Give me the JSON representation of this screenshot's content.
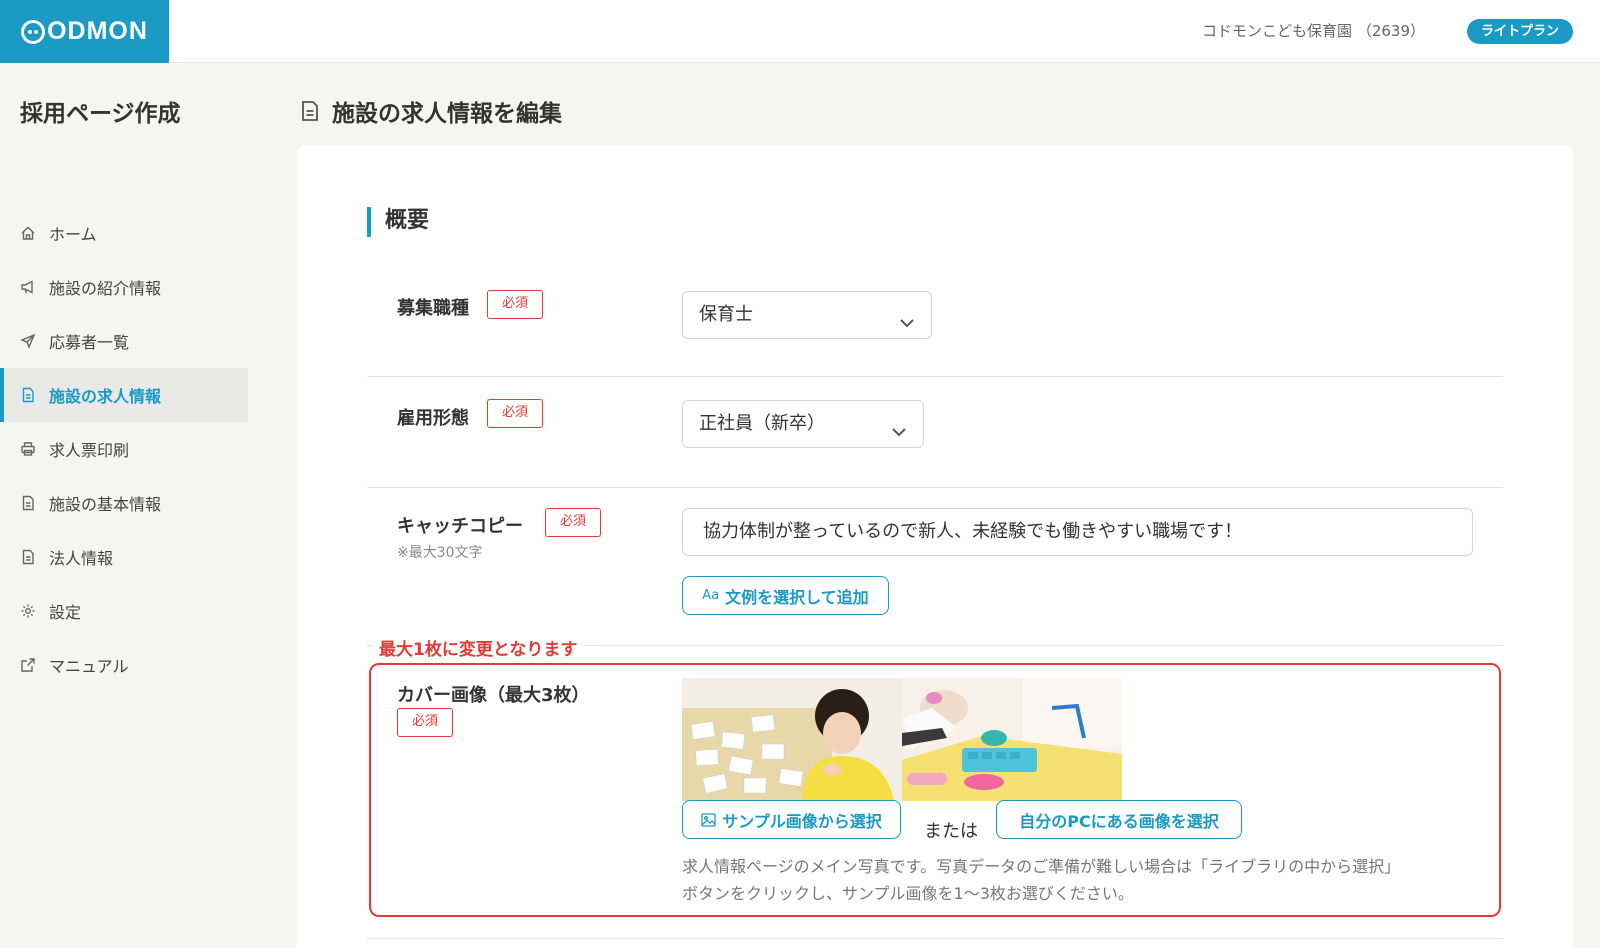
{
  "header": {
    "logo_text": "ODMON",
    "facility_name": "コドモンこども保育園 （2639）",
    "plan_badge": "ライトプラン",
    "brand_color": "#1a9ac4"
  },
  "sidebar": {
    "title": "採用ページ作成",
    "items": [
      {
        "label": "ホーム",
        "icon": "home-icon"
      },
      {
        "label": "施設の紹介情報",
        "icon": "megaphone-icon"
      },
      {
        "label": "応募者一覧",
        "icon": "send-icon"
      },
      {
        "label": "施設の求人情報",
        "icon": "document-icon",
        "active": true
      },
      {
        "label": "求人票印刷",
        "icon": "printer-icon"
      },
      {
        "label": "施設の基本情報",
        "icon": "document-icon"
      },
      {
        "label": "法人情報",
        "icon": "document-icon"
      },
      {
        "label": "設定",
        "icon": "gear-icon"
      },
      {
        "label": "マニュアル",
        "icon": "external-link-icon"
      }
    ]
  },
  "page": {
    "heading": "施設の求人情報を編集",
    "section_title": "概要"
  },
  "form": {
    "required_label": "必須",
    "job_type": {
      "label": "募集職種",
      "value": "保育士"
    },
    "employment_type": {
      "label": "雇用形態",
      "value": "正社員（新卒）"
    },
    "catch_copy": {
      "label": "キャッチコピー",
      "hint": "※最大30文字",
      "value": "協力体制が整っているので新人、未経験でも働きやすい職場です！",
      "example_button": "文例を選択して追加",
      "example_icon_text": "Aa"
    },
    "cover_image": {
      "notice": "最大1枚に変更となります",
      "label": "カバー画像（最大3枚）",
      "sample_button": "サンプル画像から選択",
      "or_text": "または",
      "pc_button": "自分のPCにある画像を選択",
      "description_line1": "求人情報ページのメイン写真です。写真データのご準備が難しい場合は「ライブラリの中から選択」",
      "description_line2": "ボタンをクリックし、サンプル画像を1〜3枚お選びください。"
    }
  },
  "colors": {
    "accent": "#1a9ac4",
    "required": "#e53935"
  }
}
